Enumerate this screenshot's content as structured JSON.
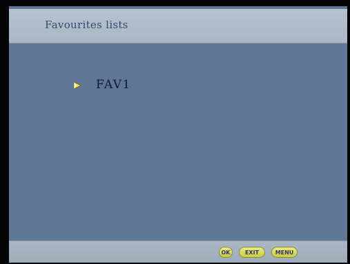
{
  "header": {
    "title": "Favourites lists"
  },
  "list": {
    "items": [
      {
        "label": "FAV1",
        "selected": true,
        "icon": "right-arrow-icon"
      }
    ]
  },
  "footer": {
    "buttons": [
      {
        "label": "OK"
      },
      {
        "label": "EXIT"
      },
      {
        "label": "MENU"
      }
    ]
  },
  "colors": {
    "background": "#5f7696",
    "bar": "#aab6c3",
    "title_text": "#334a6a",
    "item_text": "#0f1830",
    "arrow": "#f2e25a",
    "button": "#d6dc5c"
  }
}
